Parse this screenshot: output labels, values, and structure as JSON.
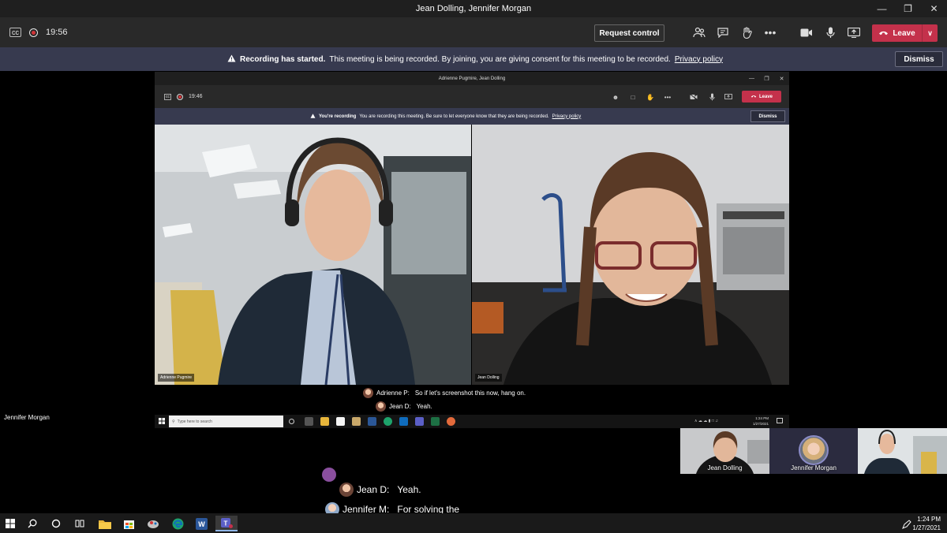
{
  "window": {
    "title": "Jean Dolling, Jennifer Morgan"
  },
  "toolbar": {
    "timer": "19:56",
    "request_control": "Request control",
    "leave": "Leave",
    "leave_color": "#c4314b"
  },
  "banner": {
    "bold": "Recording has started.",
    "text": "This meeting is being recorded. By joining, you are giving consent for this meeting to be recorded.",
    "link": "Privacy policy",
    "dismiss": "Dismiss"
  },
  "shared": {
    "title": "Adrienne Pugmire, Jean Dolling",
    "timer": "19:46",
    "leave": "Leave",
    "banner_bold": "You're recording",
    "banner_text": "You are recording this meeting. Be sure to let everyone know that they are being recorded.",
    "banner_link": "Privacy policy",
    "dismiss": "Dismiss",
    "video_left_name": "Adrienne Pugmire",
    "video_right_name": "Jean Dolling",
    "captions": [
      {
        "speaker": "Adrienne P:",
        "text": "So if let's screenshot this now, hang on."
      },
      {
        "speaker": "Jean D:",
        "text": "Yeah."
      }
    ],
    "search_placeholder": "Type here to search",
    "clock_time": "1:24 PM",
    "clock_date": "1/27/2021"
  },
  "presenter_name": "Jennifer Morgan",
  "thumbnails": [
    {
      "name": "Jean Dolling"
    },
    {
      "name": "Jennifer Morgan"
    },
    {
      "name": ""
    }
  ],
  "captions": [
    {
      "speaker": "Jean D:",
      "text": "Yeah."
    },
    {
      "speaker": "Jennifer M:",
      "text": "For solving the"
    }
  ],
  "taskbar": {
    "clock_time": "1:24 PM",
    "clock_date": "1/27/2021"
  }
}
